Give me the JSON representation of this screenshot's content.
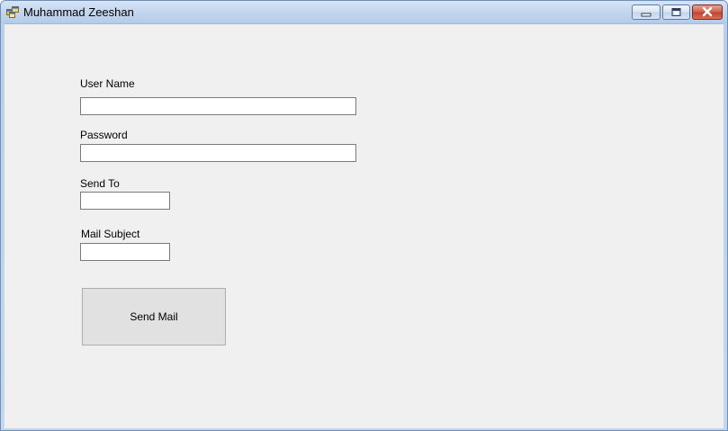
{
  "window": {
    "title": "Muhammad Zeeshan",
    "icons": {
      "app": "app-window-icon",
      "minimize": "minimize-icon",
      "maximize": "maximize-icon",
      "close": "close-icon"
    }
  },
  "form": {
    "username": {
      "label": "User Name",
      "value": ""
    },
    "password": {
      "label": "Password",
      "value": ""
    },
    "send_to": {
      "label": "Send To",
      "value": ""
    },
    "mail_subject": {
      "label": "Mail Subject",
      "value": ""
    },
    "send_button_label": "Send Mail"
  },
  "colors": {
    "client_background": "#f0f0f0",
    "close_button": "#c2452e",
    "title_bar": "#c2d6ef"
  }
}
